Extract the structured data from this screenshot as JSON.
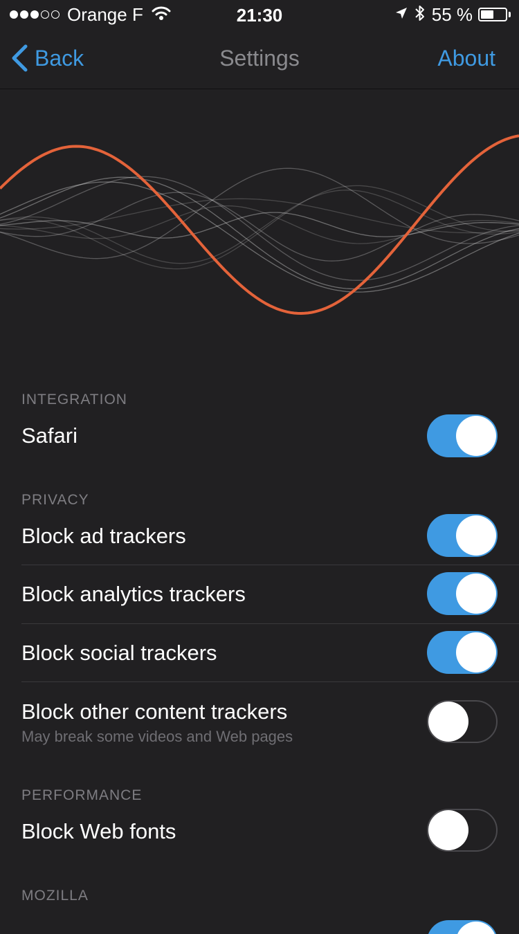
{
  "status_bar": {
    "carrier": "Orange F",
    "time": "21:30",
    "battery_percent": "55 %",
    "signal_bars": 3,
    "signal_total": 5,
    "battery_level": 0.55
  },
  "nav": {
    "back_label": "Back",
    "title": "Settings",
    "about_label": "About"
  },
  "colors": {
    "accent": "#3f9ae2",
    "wave_highlight": "#e4633a",
    "background": "#212022"
  },
  "sections": {
    "integration": {
      "header": "INTEGRATION",
      "safari": {
        "label": "Safari",
        "enabled": true
      }
    },
    "privacy": {
      "header": "PRIVACY",
      "block_ad": {
        "label": "Block ad trackers",
        "enabled": true
      },
      "block_analytics": {
        "label": "Block analytics trackers",
        "enabled": true
      },
      "block_social": {
        "label": "Block social trackers",
        "enabled": true
      },
      "block_other": {
        "label": "Block other content trackers",
        "sublabel": "May break some videos and Web pages",
        "enabled": false
      }
    },
    "performance": {
      "header": "PERFORMANCE",
      "block_fonts": {
        "label": "Block Web fonts",
        "enabled": false
      }
    },
    "mozilla": {
      "header": "MOZILLA",
      "next_toggle_enabled": true
    }
  }
}
